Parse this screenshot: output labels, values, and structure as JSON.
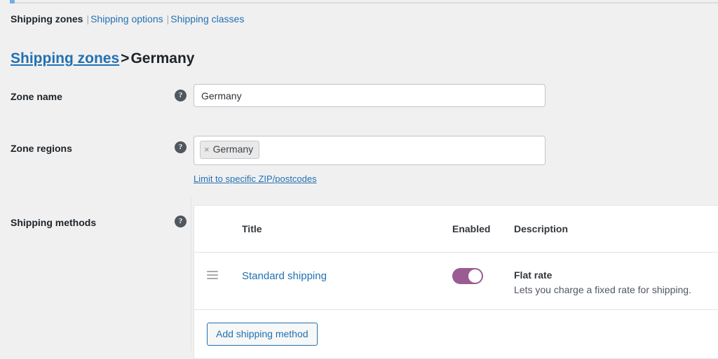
{
  "subnav": {
    "items": [
      {
        "label": "Shipping zones",
        "current": true
      },
      {
        "label": "Shipping options",
        "current": false
      },
      {
        "label": "Shipping classes",
        "current": false
      }
    ],
    "separator": "|"
  },
  "breadcrumb": {
    "parent": "Shipping zones",
    "separator": ">",
    "current": "Germany"
  },
  "form": {
    "zone_name": {
      "label": "Zone name",
      "help_icon": "question-mark-icon",
      "value": "Germany",
      "placeholder": "Zone name"
    },
    "zone_regions": {
      "label": "Zone regions",
      "help_icon": "question-mark-icon",
      "tags": [
        {
          "remove_icon": "×",
          "label": "Germany"
        }
      ],
      "limit_link": "Limit to specific ZIP/postcodes"
    },
    "shipping_methods": {
      "label": "Shipping methods",
      "help_icon": "question-mark-icon"
    }
  },
  "methods_table": {
    "columns": [
      "",
      "Title",
      "Enabled",
      "Description"
    ],
    "rows": [
      {
        "handle_icon": "drag-handle-icon",
        "title": "Standard shipping",
        "enabled": true,
        "toggle_color": "#9a5c93",
        "desc_title": "Flat rate",
        "desc_sub": "Lets you charge a fixed rate for shipping."
      }
    ],
    "add_button": "Add shipping method"
  },
  "colors": {
    "link": "#2271b1",
    "page_bg": "#f0f0f1",
    "toggle_on": "#9a5c93",
    "top_marker": "#72aee6"
  }
}
